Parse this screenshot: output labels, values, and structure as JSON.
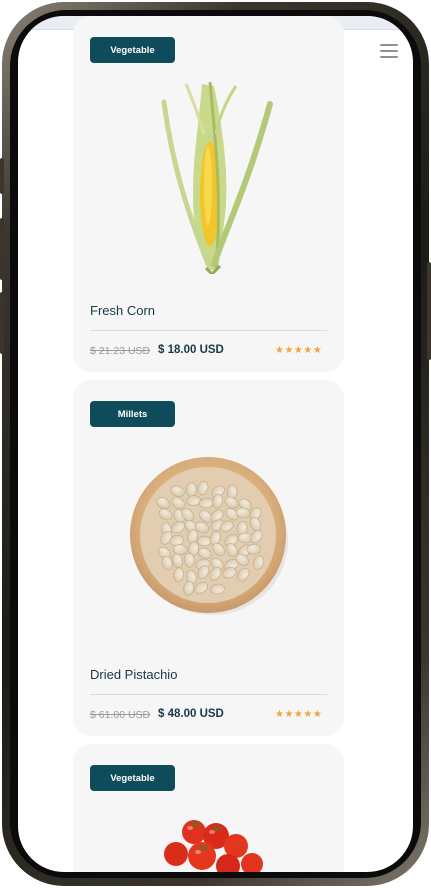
{
  "header": {
    "menu_icon": "hamburger-menu-icon"
  },
  "products": [
    {
      "category": "Vegetable",
      "name": "Fresh Corn",
      "old_price": "$ 21.23 USD",
      "price": "$ 18.00 USD",
      "stars": "★★★★★",
      "image_icon": "corn-image"
    },
    {
      "category": "Millets",
      "name": "Dried Pistachio",
      "old_price": "$ 61.00 USD",
      "price": "$ 48.00 USD",
      "stars": "★★★★★",
      "image_icon": "pistachio-bowl-image"
    },
    {
      "category": "Vegetable",
      "image_icon": "cherry-tomatoes-image"
    }
  ],
  "colors": {
    "badge": "#0e4c5c",
    "title": "#163948",
    "star": "#f1a43a",
    "card_bg": "#f7f6f7"
  }
}
